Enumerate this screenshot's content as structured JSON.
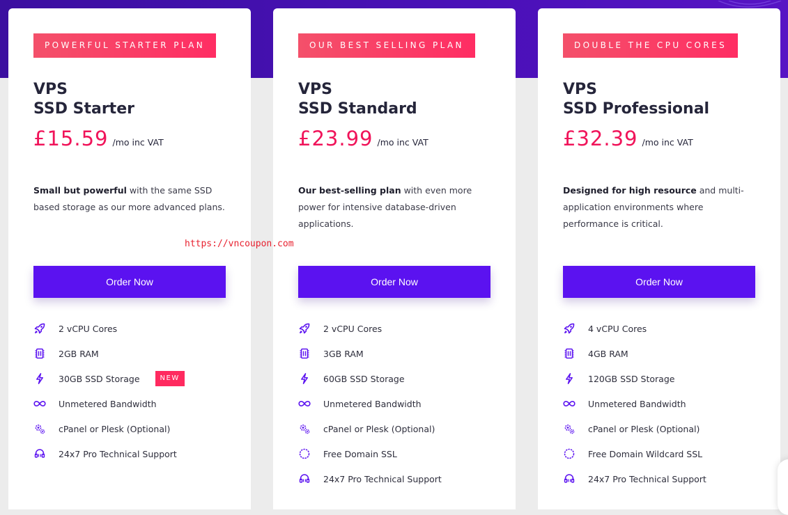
{
  "plans": [
    {
      "badge": "POWERFUL STARTER PLAN",
      "title_line1": "VPS",
      "title_line2": "SSD Starter",
      "price": "£15.59",
      "price_suffix": "/mo inc VAT",
      "desc_bold": "Small but powerful",
      "desc_rest": " with the same SSD based storage as our more advanced plans.",
      "order_label": "Order Now",
      "features": [
        {
          "icon": "rocket-icon",
          "text": "2 vCPU Cores"
        },
        {
          "icon": "memory-chip-icon",
          "text": "2GB RAM"
        },
        {
          "icon": "lightning-icon",
          "text": "30GB SSD Storage",
          "badge": "NEW"
        },
        {
          "icon": "infinity-icon",
          "text": "Unmetered Bandwidth"
        },
        {
          "icon": "gears-icon",
          "text": "cPanel or Plesk (Optional)"
        },
        {
          "icon": "headset-icon",
          "text": "24x7 Pro Technical Support"
        }
      ]
    },
    {
      "badge": "OUR BEST SELLING PLAN",
      "title_line1": "VPS",
      "title_line2": "SSD Standard",
      "price": "£23.99",
      "price_suffix": "/mo inc VAT",
      "desc_bold": "Our best-selling plan",
      "desc_rest": " with even more power for intensive database-driven applications.",
      "order_label": "Order Now",
      "features": [
        {
          "icon": "rocket-icon",
          "text": "2 vCPU Cores"
        },
        {
          "icon": "memory-chip-icon",
          "text": "3GB RAM"
        },
        {
          "icon": "lightning-icon",
          "text": "60GB SSD Storage"
        },
        {
          "icon": "infinity-icon",
          "text": "Unmetered Bandwidth"
        },
        {
          "icon": "gears-icon",
          "text": "cPanel or Plesk (Optional)"
        },
        {
          "icon": "ssl-badge-icon",
          "text": "Free Domain SSL"
        },
        {
          "icon": "headset-icon",
          "text": "24x7 Pro Technical Support"
        }
      ]
    },
    {
      "badge": "DOUBLE THE CPU CORES",
      "title_line1": "VPS",
      "title_line2": "SSD Professional",
      "price": "£32.39",
      "price_suffix": "/mo inc VAT",
      "desc_bold": "Designed for high resource",
      "desc_rest": " and multi-application environments where performance is critical.",
      "order_label": "Order Now",
      "features": [
        {
          "icon": "rocket-icon",
          "text": "4 vCPU Cores"
        },
        {
          "icon": "memory-chip-icon",
          "text": "4GB RAM"
        },
        {
          "icon": "lightning-icon",
          "text": "120GB SSD Storage"
        },
        {
          "icon": "infinity-icon",
          "text": "Unmetered Bandwidth"
        },
        {
          "icon": "gears-icon",
          "text": "cPanel or Plesk (Optional)"
        },
        {
          "icon": "ssl-badge-icon",
          "text": "Free Domain Wildcard SSL"
        },
        {
          "icon": "headset-icon",
          "text": "24x7 Pro Technical Support"
        }
      ]
    }
  ],
  "watermark": "https://vncoupon.com",
  "colors": {
    "accent": "#5b12f0",
    "price": "#f0145a",
    "badge": "#ff2d63",
    "hero": "#4a10b8",
    "icon": "#5b12f0"
  }
}
